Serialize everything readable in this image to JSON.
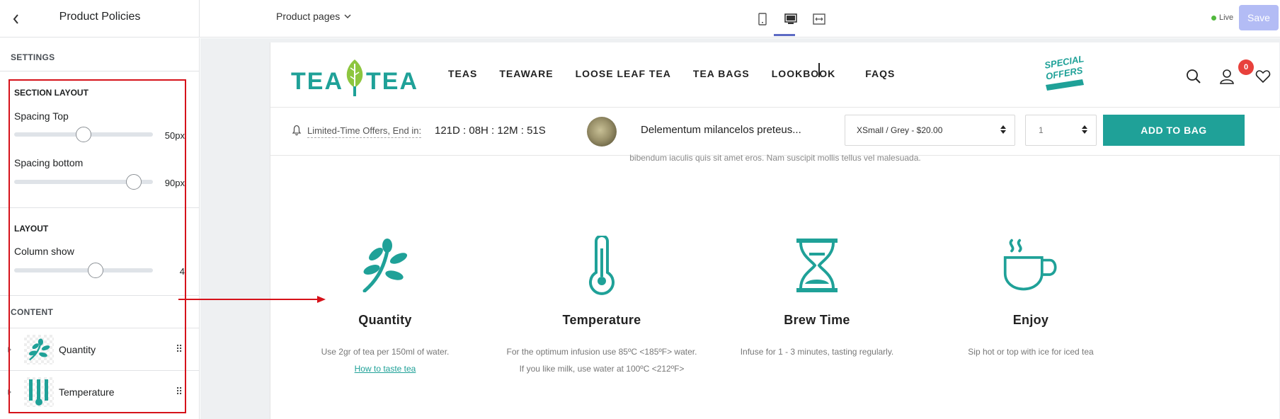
{
  "topbar": {
    "title": "Product Policies",
    "page_select": "Product pages",
    "live_label": "Live",
    "save_label": "Save",
    "devices": [
      "mobile",
      "desktop",
      "full-width"
    ],
    "active_device": "desktop"
  },
  "sidebar": {
    "settings_label": "SETTINGS",
    "section_layout_title": "SECTION LAYOUT",
    "spacing_top": {
      "label": "Spacing Top",
      "value": "50px",
      "fraction": 0.41
    },
    "spacing_bottom": {
      "label": "Spacing bottom",
      "value": "90px",
      "fraction": 0.72
    },
    "layout_title": "LAYOUT",
    "column_show": {
      "label": "Column show",
      "value": "4",
      "fraction": 0.5
    },
    "content_label": "CONTENT",
    "content_items": [
      {
        "label": "Quantity",
        "icon": "sprig-icon"
      },
      {
        "label": "Temperature",
        "icon": "thermometer-icon"
      }
    ]
  },
  "store": {
    "logo_text_left": "TEA",
    "logo_text_right": "TEA",
    "nav": [
      "TEAS",
      "TEAWARE",
      "LOOSE LEAF TEA",
      "TEA BAGS",
      "LOOKBOOK",
      "FAQS"
    ],
    "badge_lines": [
      "SPECIAL",
      "OFFERS"
    ],
    "cart_count": "0",
    "brand_color": "#1fa198"
  },
  "sticky_bar": {
    "offer_label": "Limited-Time Offers, End in:",
    "countdown": "121D : 08H : 12M : 51S",
    "product_name": "Delementum milancelos preteus...",
    "variant": "XSmall / Grey - $20.00",
    "quantity": "1",
    "add_to_bag": "ADD TO BAG"
  },
  "faded_text": "bibendum iaculis quis sit amet eros. Nam suscipit mollis tellus vel malesuada.",
  "policies": [
    {
      "title": "Quantity",
      "desc": [
        "Use 2gr of tea per 150ml of water."
      ],
      "link": "How to taste tea",
      "icon": "sprig-icon"
    },
    {
      "title": "Temperature",
      "desc": [
        "For the optimum infusion use 85ºC <185ºF> water.",
        "If you like milk, use water at 100ºC <212ºF>"
      ],
      "icon": "thermometer-icon"
    },
    {
      "title": "Brew Time",
      "desc": [
        "Infuse for 1 - 3 minutes, tasting regularly."
      ],
      "icon": "hourglass-icon"
    },
    {
      "title": "Enjoy",
      "desc": [
        "Sip hot or top with ice for iced tea"
      ],
      "icon": "teacup-icon"
    }
  ]
}
